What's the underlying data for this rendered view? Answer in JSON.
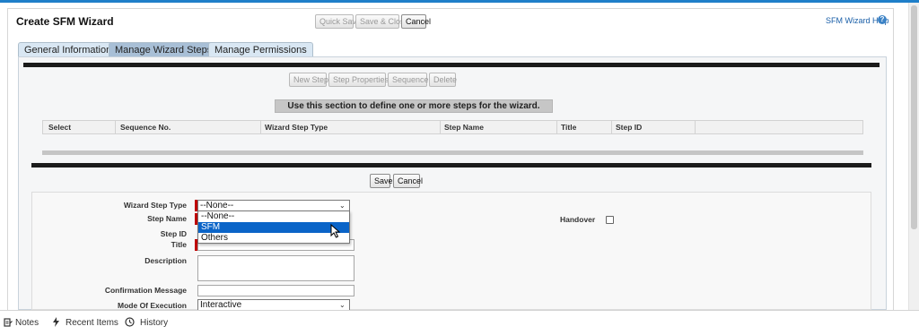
{
  "page": {
    "title": "Create SFM Wizard",
    "help_label": "SFM Wizard Help",
    "help_icon": "?"
  },
  "header_buttons": {
    "quick_save": "Quick Save",
    "save_close": "Save & Close",
    "cancel": "Cancel"
  },
  "tabs": [
    {
      "label": "General Information",
      "active": false
    },
    {
      "label": "Manage Wizard Steps",
      "active": true
    },
    {
      "label": "Manage Permissions",
      "active": false
    }
  ],
  "steps_toolbar": {
    "new_step": "New Step",
    "step_properties": "Step Properties",
    "sequence": "Sequence",
    "delete": "Delete"
  },
  "instruction": "Use this section to define one or more steps for the wizard.",
  "grid_columns": [
    "Select",
    "Sequence No.",
    "Wizard Step Type",
    "Step Name",
    "Title",
    "Step ID"
  ],
  "form_buttons": {
    "save": "Save",
    "cancel": "Cancel"
  },
  "form": {
    "wizard_step_type_label": "Wizard Step Type",
    "wizard_step_type_value": "--None--",
    "step_name_label": "Step Name",
    "step_id_label": "Step ID",
    "title_label": "Title",
    "description_label": "Description",
    "confirmation_label": "Confirmation Message",
    "mode_label": "Mode Of Execution",
    "mode_value": "Interactive",
    "handover_label": "Handover"
  },
  "dropdown_options": [
    {
      "label": "--None--",
      "highlighted": false
    },
    {
      "label": "SFM",
      "highlighted": true
    },
    {
      "label": "Others",
      "highlighted": false
    }
  ],
  "footer": {
    "notes": "Notes",
    "recent_items": "Recent Items",
    "history": "History"
  },
  "colors": {
    "accent": "#1f7fc9",
    "selected_option": "#0a64c8",
    "required": "#c00000"
  }
}
